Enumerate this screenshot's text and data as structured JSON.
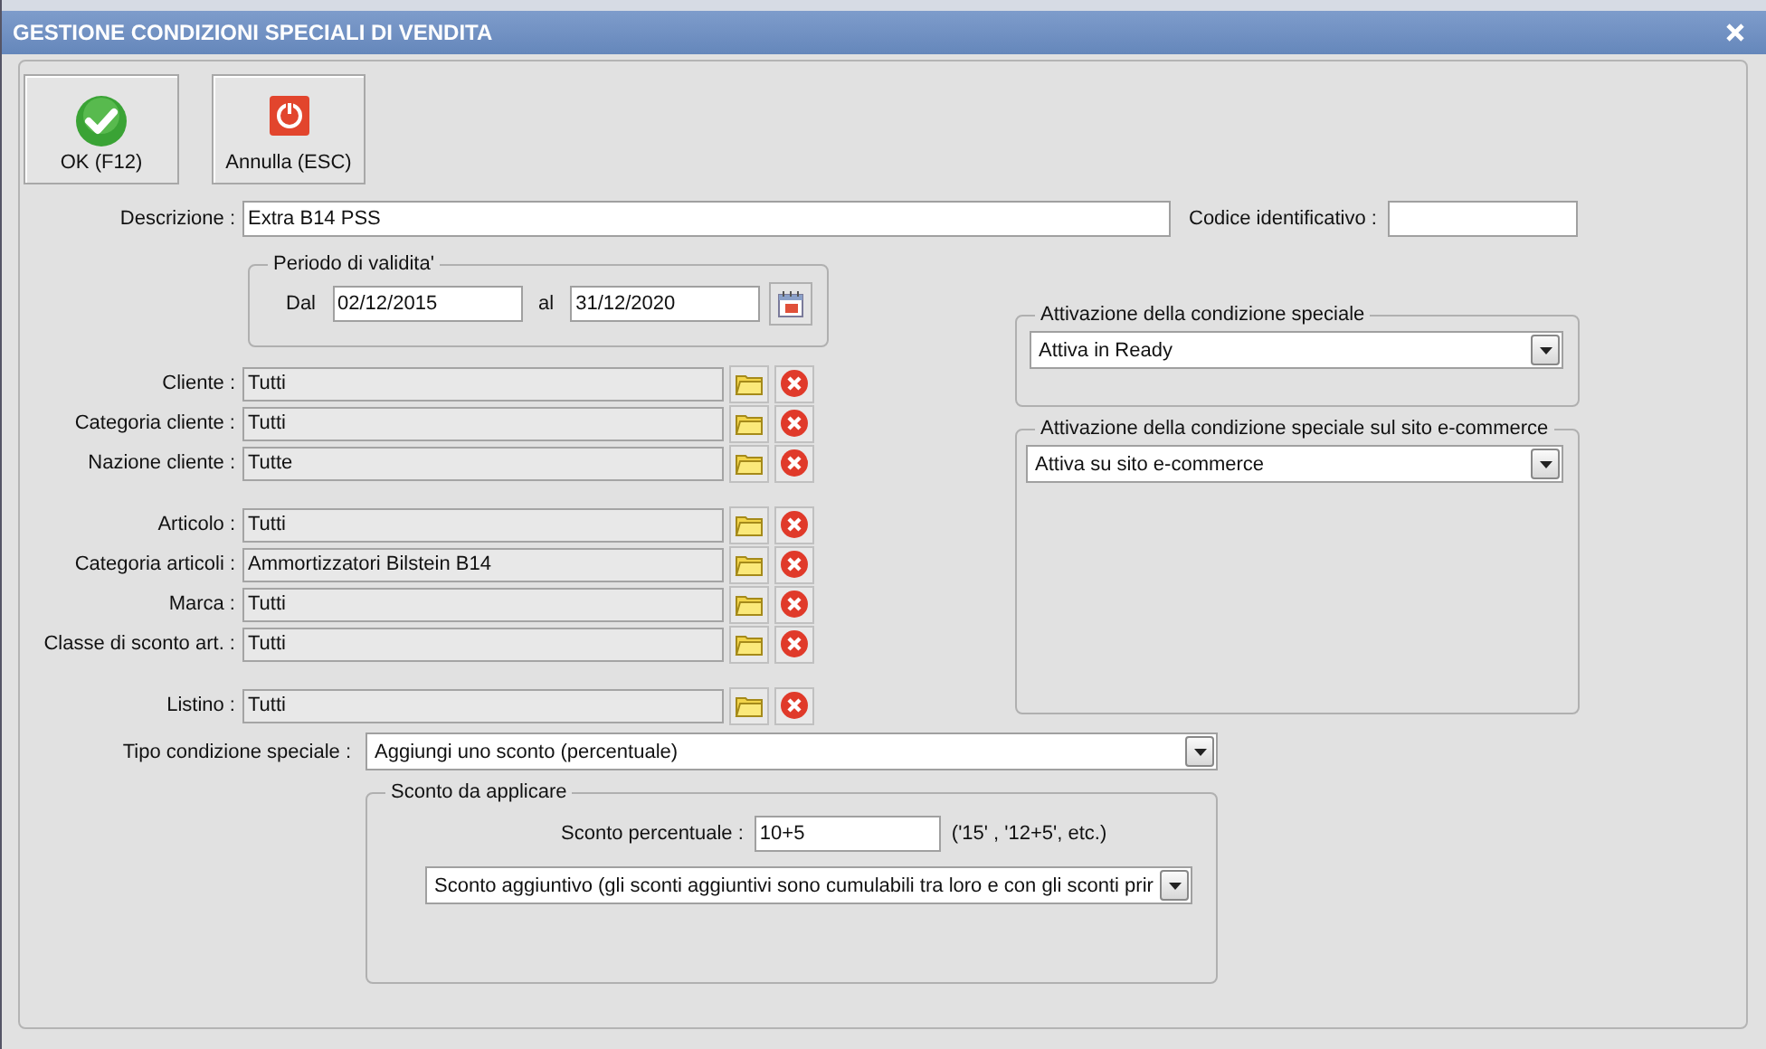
{
  "window": {
    "title": "GESTIONE CONDIZIONI SPECIALI DI VENDITA"
  },
  "toolbar": [
    {
      "label": "OK (F12)",
      "kind": "ok"
    },
    {
      "label": "Annulla (ESC)",
      "kind": "cancel"
    }
  ],
  "descrizione": {
    "label": "Descrizione :",
    "value": "Extra B14 PSS"
  },
  "codice": {
    "label": "Codice identificativo :"
  },
  "periodo": {
    "title": "Periodo di validita'",
    "from_label": "Dal",
    "from": "02/12/2015",
    "to_label": "al",
    "to": "31/12/2020"
  },
  "lookup_groups": [
    [
      {
        "label": "Cliente :",
        "value": "Tutti"
      },
      {
        "label": "Categoria cliente :",
        "value": "Tutti"
      },
      {
        "label": "Nazione cliente :",
        "value": "Tutte"
      }
    ],
    [
      {
        "label": "Articolo :",
        "value": "Tutti"
      },
      {
        "label": "Categoria articoli :",
        "value": "Ammortizzatori Bilstein B14"
      },
      {
        "label": "Marca :",
        "value": "Tutti"
      },
      {
        "label": "Classe di sconto art. :",
        "value": "Tutti"
      }
    ],
    [
      {
        "label": "Listino :",
        "value": "Tutti"
      }
    ]
  ],
  "attivazione": {
    "title": "Attivazione della condizione speciale",
    "value": "Attiva in Ready"
  },
  "ecommerce": {
    "title": "Attivazione della condizione speciale sul sito e-commerce",
    "value": "Attiva su sito e-commerce"
  },
  "tipo": {
    "label": "Tipo condizione speciale :",
    "value": "Aggiungi uno sconto (percentuale)"
  },
  "sconto": {
    "title": "Sconto da applicare",
    "label": "Sconto percentuale :",
    "value": "10+5",
    "hint": "('15' , '12+5', etc.)",
    "mode": "Sconto aggiuntivo (gli sconti aggiuntivi sono cumulabili tra loro e con gli sconti prir"
  }
}
